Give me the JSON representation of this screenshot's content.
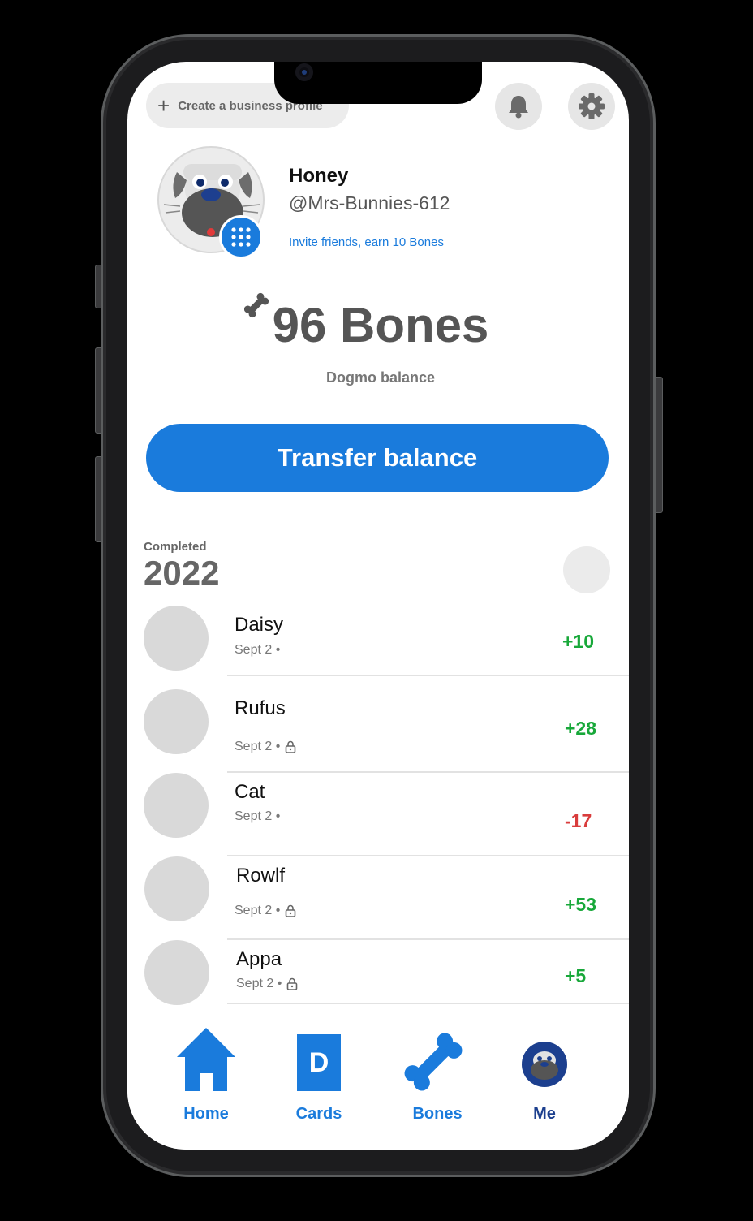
{
  "header": {
    "business_label": "Create a business profile",
    "notification_icon": "bell-icon",
    "settings_icon": "gear-icon"
  },
  "profile": {
    "name": "Honey",
    "handle": "@Mrs-Bunnies-612",
    "invite_text": "Invite friends, earn 10 Bones",
    "avatar_icon": "dog-avatar",
    "badge_icon": "qr-grid-icon"
  },
  "balance": {
    "amount": "96 Bones",
    "label": "Dogmo balance"
  },
  "actions": {
    "transfer_label": "Transfer balance"
  },
  "history": {
    "section_label": "Completed",
    "year": "2022",
    "items": [
      {
        "name": "Daisy",
        "date": "Sept 2 •",
        "amount": "+10",
        "private": false,
        "type": "pos"
      },
      {
        "name": "Rufus",
        "date": "Sept 2 •",
        "amount": "+28",
        "private": true,
        "type": "pos"
      },
      {
        "name": "Cat",
        "date": "Sept 2 •",
        "amount": "-17",
        "private": false,
        "type": "neg"
      },
      {
        "name": "Rowlf",
        "date": "Sept 2 •",
        "amount": "+53",
        "private": true,
        "type": "pos"
      },
      {
        "name": "Appa",
        "date": "Sept 2 •",
        "amount": "+5",
        "private": true,
        "type": "pos"
      }
    ]
  },
  "tabs": [
    {
      "label": "Home",
      "icon": "home-icon"
    },
    {
      "label": "Cards",
      "icon": "card-icon"
    },
    {
      "label": "Bones",
      "icon": "bone-icon"
    },
    {
      "label": "Me",
      "icon": "avatar-icon"
    }
  ],
  "colors": {
    "accent": "#1a7bdc",
    "positive": "#18a83a",
    "negative": "#d93c3c",
    "me_tab": "#1c3f8e"
  }
}
